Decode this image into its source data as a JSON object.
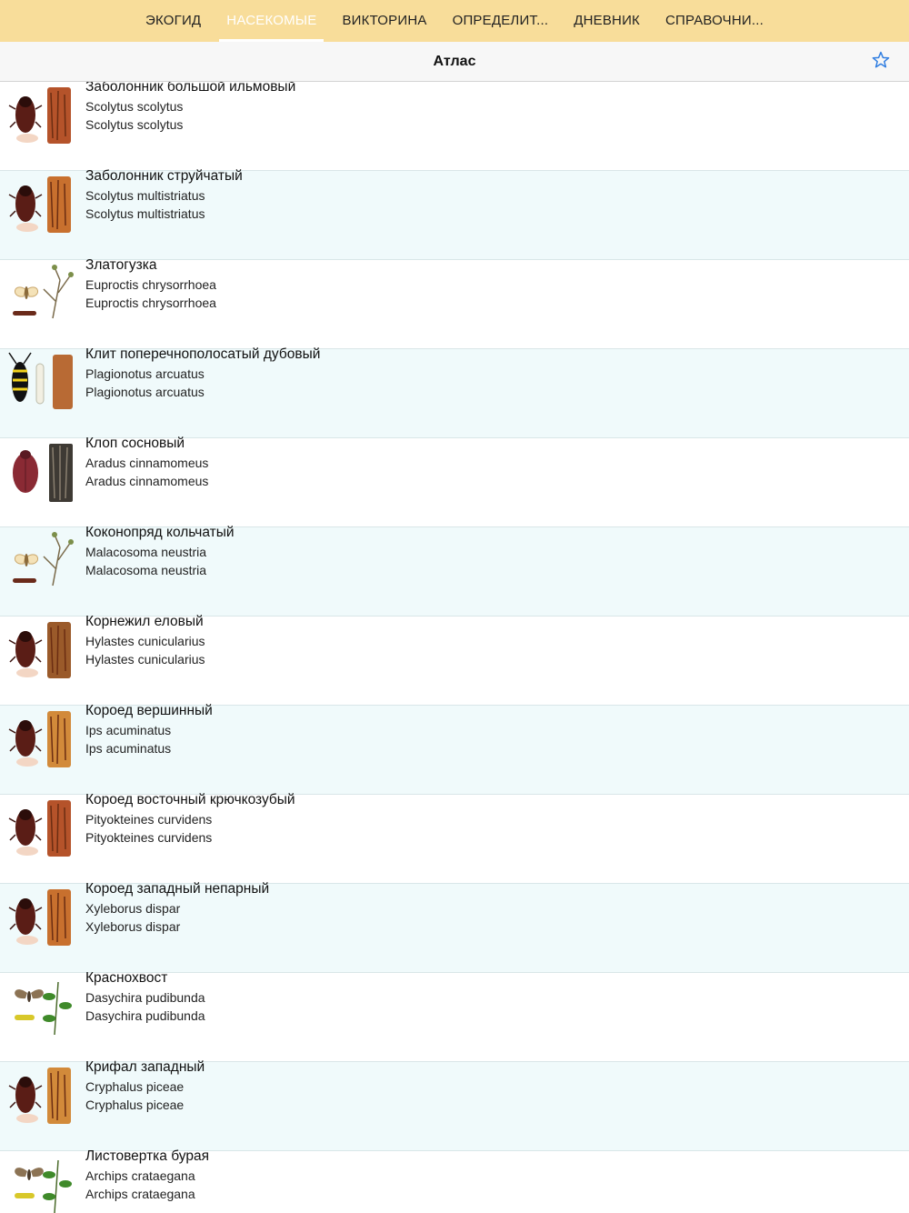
{
  "tabs": [
    {
      "label": "ЭКОГИД",
      "active": false
    },
    {
      "label": "НАСЕКОМЫЕ",
      "active": true
    },
    {
      "label": "ВИКТОРИНА",
      "active": false
    },
    {
      "label": "ОПРЕДЕЛИТ...",
      "active": false
    },
    {
      "label": "ДНЕВНИК",
      "active": false
    },
    {
      "label": "СПРАВОЧНИ...",
      "active": false
    }
  ],
  "header": {
    "title": "Атлас",
    "favorite_icon": "star-outline-icon",
    "accent": "#2f7de1"
  },
  "colors": {
    "nav_bg": "#f8dd9a",
    "row_alt_bg": "#f0fafb"
  },
  "items": [
    {
      "name": "Заболонник большой ильмовый",
      "latin1": "Scolytus scolytus",
      "latin2": "Scolytus scolytus",
      "icon": "beetle-bark-icon"
    },
    {
      "name": "Заболонник струйчатый",
      "latin1": "Scolytus multistriatus",
      "latin2": "Scolytus multistriatus",
      "icon": "beetle-bark-icon"
    },
    {
      "name": "Златогузка",
      "latin1": "Euproctis chrysorrhoea",
      "latin2": "Euproctis chrysorrhoea",
      "icon": "moth-branch-icon"
    },
    {
      "name": "Клит поперечнополосатый дубовый",
      "latin1": "Plagionotus arcuatus",
      "latin2": "Plagionotus arcuatus",
      "icon": "longhorn-beetle-icon"
    },
    {
      "name": "Клоп сосновый",
      "latin1": "Aradus cinnamomeus",
      "latin2": "Aradus cinnamomeus",
      "icon": "bug-bark-icon"
    },
    {
      "name": "Коконопряд кольчатый",
      "latin1": "Malacosoma neustria",
      "latin2": "Malacosoma neustria",
      "icon": "moth-branch-icon"
    },
    {
      "name": "Корнежил еловый",
      "latin1": "Hylastes cunicularius",
      "latin2": "Hylastes cunicularius",
      "icon": "beetle-bark-icon"
    },
    {
      "name": "Короед вершинный",
      "latin1": "Ips acuminatus",
      "latin2": "Ips acuminatus",
      "icon": "beetle-bark-icon"
    },
    {
      "name": "Короед восточный крючкозубый",
      "latin1": "Pityokteines curvidens",
      "latin2": "Pityokteines curvidens",
      "icon": "beetle-bark-icon"
    },
    {
      "name": "Короед западный непарный",
      "latin1": "Xyleborus dispar",
      "latin2": "Xyleborus dispar",
      "icon": "beetle-bark-icon"
    },
    {
      "name": "Краснохвост",
      "latin1": "Dasychira pudibunda",
      "latin2": "Dasychira pudibunda",
      "icon": "moth-leaves-icon"
    },
    {
      "name": "Крифал западный",
      "latin1": "Cryphalus piceae",
      "latin2": "Cryphalus piceae",
      "icon": "beetle-bark-icon"
    },
    {
      "name": "Листовертка бурая",
      "latin1": "Archips crataegana",
      "latin2": "Archips crataegana",
      "icon": "moth-leaves-icon"
    }
  ]
}
